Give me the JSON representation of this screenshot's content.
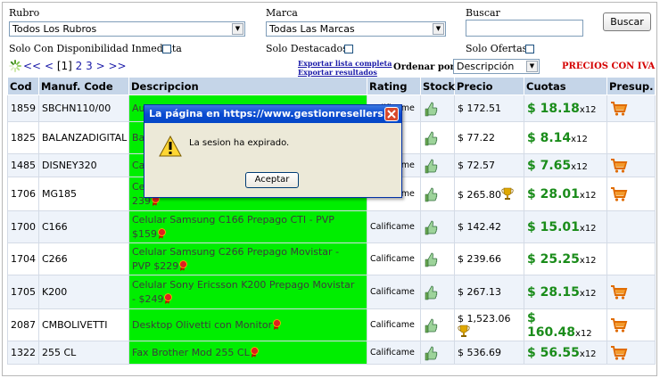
{
  "filters": {
    "rubro_label": "Rubro",
    "rubro_value": "Todos Los Rubros",
    "marca_label": "Marca",
    "marca_value": "Todas Las Marcas",
    "buscar_label": "Buscar",
    "buscar_value": "",
    "buscar_button": "Buscar",
    "solo_disponibilidad": "Solo Con Disponibilidad Inmediata",
    "solo_destacados": "Solo Destacados",
    "solo_ofertas": "Solo Ofertas"
  },
  "pager": {
    "prev_first": "<<",
    "prev": "<",
    "current": "[1]",
    "page2": "2",
    "page3": "3",
    "next": ">",
    "next_last": ">>"
  },
  "export": {
    "lista_completa": "Exportar lista completa",
    "resultados": "Exportar resultados"
  },
  "order": {
    "label": "Ordenar por:",
    "value": "Descripción"
  },
  "precios_con_iva": "PRECIOS CON IVA",
  "table": {
    "headers": [
      "Cod",
      "Manuf. Code",
      "Descripcion",
      "Rating",
      "Stock",
      "Precio",
      "Cuotas",
      "Presup."
    ],
    "rows": [
      {
        "cod": "1859",
        "manuf": "SBCHN110/00",
        "desc": "Auricular Philips In-Ear SBCHN110/00 (C",
        "rating": "Calificame",
        "precio": "$ 172.51",
        "cuota": "$ 18.18",
        "cuota_x": "x12"
      },
      {
        "cod": "1825",
        "manuf": "BALANZADIGITAL",
        "desc": "Ba",
        "rating": "☆☆",
        "precio": "$ 77.22",
        "cuota": "$ 8.14",
        "cuota_x": "x12"
      },
      {
        "cod": "1485",
        "manuf": "DISNEY320",
        "desc": "Ca",
        "rating": "Calificame",
        "precio": "$ 72.57",
        "cuota": "$ 7.65",
        "cuota_x": "x12"
      },
      {
        "cod": "1706",
        "manuf": "MG185",
        "desc": "Ce",
        "desc2": "239",
        "rating": "Calificame",
        "precio": "$ 265.80",
        "cuota": "$ 28.01",
        "cuota_x": "x12"
      },
      {
        "cod": "1700",
        "manuf": "C166",
        "desc": "Celular Samsung C166 Prepago CTI - PVP",
        "desc2": "$159",
        "rating": "Calificame",
        "precio": "$ 142.42",
        "cuota": "$ 15.01",
        "cuota_x": "x12"
      },
      {
        "cod": "1704",
        "manuf": "C266",
        "desc": "Celular Samsung C266 Prepago Movistar -",
        "desc2": "PVP $229",
        "rating": "Calificame",
        "precio": "$ 239.66",
        "cuota": "$ 25.25",
        "cuota_x": "x12"
      },
      {
        "cod": "1705",
        "manuf": "K200",
        "desc": "Celular Sony Ericsson K200 Prepago Movistar",
        "desc2": "- $249",
        "rating": "Calificame",
        "precio": "$ 267.13",
        "cuota": "$ 28.15",
        "cuota_x": "x12"
      },
      {
        "cod": "2087",
        "manuf": "CMBOLIVETTI",
        "desc": "Desktop Olivetti con Monitor",
        "rating": "Calificame",
        "precio": "$ 1,523.06",
        "cuota": "$ 160.48",
        "cuota_x": "x12"
      },
      {
        "cod": "1322",
        "manuf": "255 CL",
        "desc": "Fax Brother Mod 255 CL",
        "rating": "Calificame",
        "precio": "$ 536.69",
        "cuota": "$ 56.55",
        "cuota_x": "x12"
      }
    ]
  },
  "dialog": {
    "title": "La página en https://www.gestionresellers...",
    "message": "La sesion ha expirado.",
    "ok_button": "Aceptar"
  },
  "colors": {
    "header_bg": "#c5d5e8",
    "desc_bg": "#00ee00",
    "cuota_green": "#1a8c1a",
    "precios_red": "#d40000",
    "link_blue": "#1a1aa8"
  }
}
